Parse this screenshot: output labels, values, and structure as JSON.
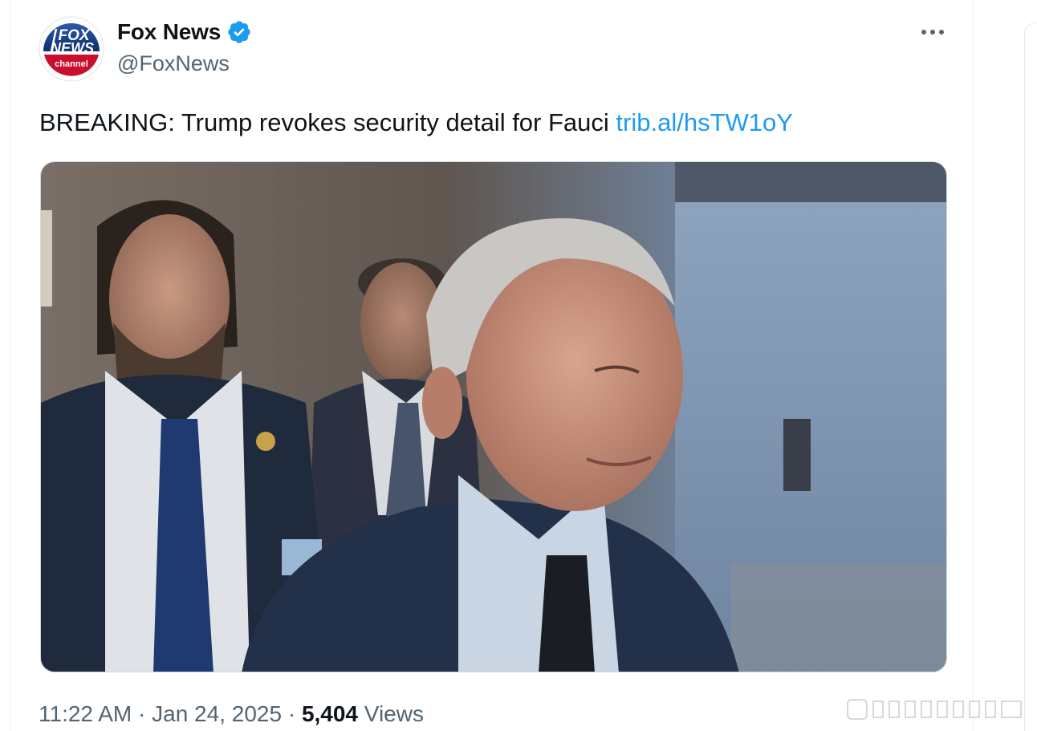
{
  "author": {
    "display_name": "Fox News",
    "handle": "@FoxNews",
    "verified": true,
    "avatar_logo_lines": [
      "FOX",
      "NEWS",
      "channel"
    ],
    "avatar_icon": "fox-news-logo-icon"
  },
  "tweet": {
    "text": "BREAKING: Trump revokes security detail for Fauci ",
    "link_text": "trib.al/hsTW1oY",
    "more_icon": "more-horizontal-icon"
  },
  "media": {
    "type": "photo"
  },
  "meta": {
    "time": "11:22 AM",
    "separator1": " · ",
    "date": "Jan 24, 2025",
    "separator2": " · ",
    "views_count": "5,404",
    "views_label": " Views"
  },
  "colors": {
    "link": "#1d9bf0",
    "secondary_text": "#536471",
    "verified_badge": "#1d9bf0"
  }
}
